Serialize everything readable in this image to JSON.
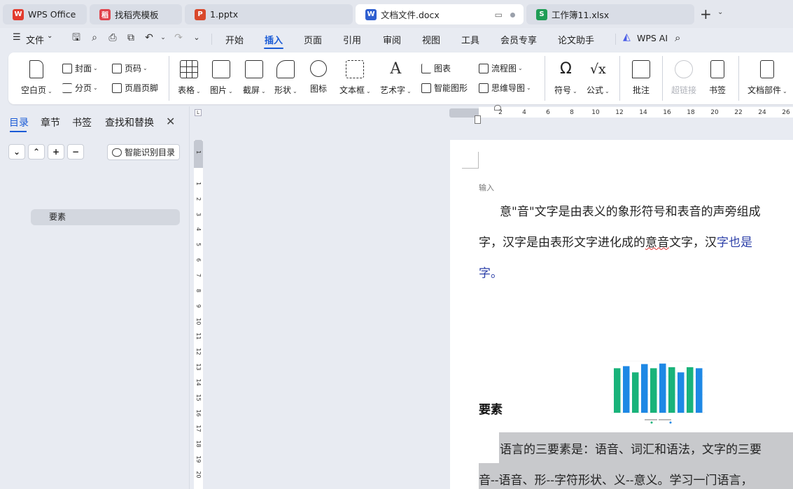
{
  "tabs": [
    {
      "label": "WPS Office",
      "icon": "wps-logo-icon",
      "color": "#e23b2e",
      "glyph": "W"
    },
    {
      "label": "找稻壳模板",
      "icon": "docer-icon",
      "color": "#e0434b",
      "glyph": "稻"
    },
    {
      "label": "1.pptx",
      "icon": "ppt-icon",
      "color": "#d9482b",
      "glyph": "P"
    },
    {
      "label": "文档文件.docx",
      "icon": "word-icon",
      "color": "#2f5fd0",
      "glyph": "W",
      "active": true
    },
    {
      "label": "工作簿11.xlsx",
      "icon": "excel-icon",
      "color": "#1f9d55",
      "glyph": "S"
    }
  ],
  "menu": {
    "file": "文件",
    "items": [
      "开始",
      "插入",
      "页面",
      "引用",
      "审阅",
      "视图",
      "工具",
      "会员专享",
      "论文助手"
    ],
    "active": "插入",
    "wps_ai": "WPS AI"
  },
  "ribbon": {
    "blank_page": "空白页",
    "cover": "封面",
    "page_break": "分页",
    "page_number": "页码",
    "header_footer": "页眉页脚",
    "table": "表格",
    "picture": "图片",
    "screenshot": "截屏",
    "shape": "形状",
    "icon": "图标",
    "textbox": "文本框",
    "wordart": "艺术字",
    "chart": "图表",
    "smart_graphic": "智能图形",
    "flowchart": "流程图",
    "mindmap": "思维导图",
    "symbol": "符号",
    "formula": "公式",
    "comment": "批注",
    "hyperlink": "超链接",
    "bookmark": "书签",
    "doc_parts": "文档部件"
  },
  "panel": {
    "tabs": [
      "目录",
      "章节",
      "书签",
      "查找和替换"
    ],
    "active": "目录",
    "smart_toc": "智能识别目录",
    "outline": [
      "要素"
    ]
  },
  "ruler": {
    "h": [
      "2",
      "4",
      "6",
      "8",
      "10",
      "12",
      "14",
      "16",
      "18",
      "20",
      "22",
      "24",
      "26"
    ],
    "v": [
      "1",
      "1",
      "2",
      "3",
      "4",
      "5",
      "6",
      "7",
      "8",
      "9",
      "10",
      "11",
      "12",
      "13",
      "14",
      "15",
      "16",
      "17",
      "18",
      "19",
      "20"
    ]
  },
  "document": {
    "hint": "输入",
    "p1_line1": "意\"音\"文字是由表义的象形符号和表音的声旁组成",
    "p1_line2_a": "字，汉字是由表形文字进化成的",
    "p1_line2_b": "意音",
    "p1_line2_c": "文字，汉",
    "p1_line2_d": "字也是",
    "p1_line3": "字。",
    "heading": "要素",
    "p2_line1": "语言的三要素是：语音、词汇和语法，文字的三要",
    "p2_line2": "音--语音、形--字符形状、义--意义。学习一门语言，"
  },
  "chart_data": {
    "type": "bar",
    "categories": [
      "",
      "",
      "",
      "",
      "",
      "",
      "",
      "",
      "",
      ""
    ],
    "values": [
      86,
      90,
      78,
      94,
      86,
      95,
      88,
      78,
      88,
      86
    ],
    "colors": [
      "#19b37a",
      "#1e88e5"
    ]
  }
}
